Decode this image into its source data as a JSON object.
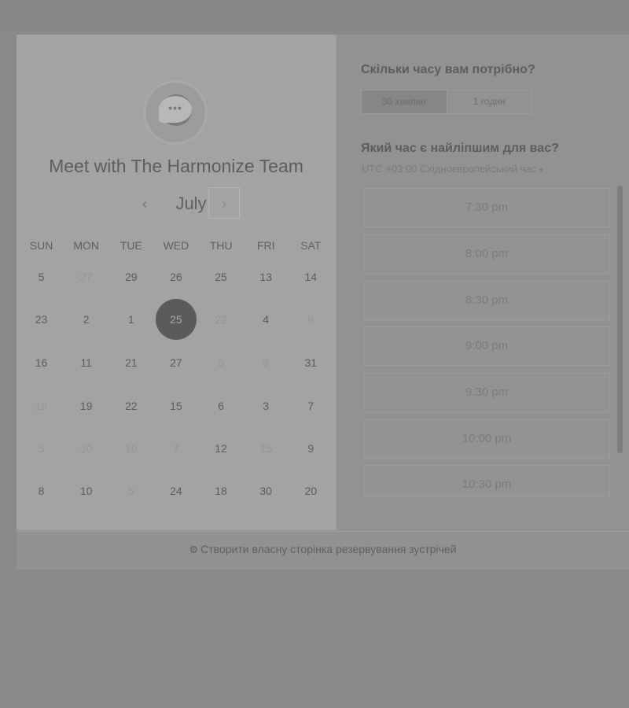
{
  "colors": {
    "selected_day": "#5b5b5b",
    "background": "#8a8a8a"
  },
  "left": {
    "title": "Meet with The Harmonize Team",
    "avatar_icon": "chat-bubble-icon",
    "avatar_text": "•••",
    "prev_icon": "‹",
    "month": "July",
    "next_icon": "›",
    "weekdays": [
      "SUN",
      "MON",
      "TUE",
      "WED",
      "THU",
      "FRI",
      "SAT"
    ],
    "weeks": [
      [
        "5",
        "27",
        "29",
        "26",
        "25",
        "13",
        "14"
      ],
      [
        "23",
        "2",
        "1",
        "25",
        "22",
        "4",
        "6"
      ],
      [
        "16",
        "11",
        "21",
        "27",
        "5",
        "8",
        "31"
      ],
      [
        "15",
        "19",
        "22",
        "15",
        "6",
        "3",
        "7"
      ],
      [
        "5",
        "30",
        "10",
        "7",
        "12",
        "15",
        "9"
      ],
      [
        "8",
        "10",
        "5",
        "24",
        "18",
        "30",
        "20"
      ]
    ],
    "selected": "25"
  },
  "right": {
    "duration_question": "Скільки часу вам потрібно?",
    "durations": [
      "30 хвилин",
      "1 годин"
    ],
    "time_question": "Який час є найліпшим для вас?",
    "timezone": "UTC +03:00 Східноєвропейський час",
    "timezone_caret": "▾",
    "slots": [
      "7:30 pm",
      "8:00 pm",
      "8:30 pm",
      "9:00 pm",
      "9:30 pm",
      "10:00 pm",
      "10:30 pm"
    ]
  },
  "footer": {
    "icon": "hubspot-sprocket-icon",
    "icon_glyph": "⚙",
    "link": "Створити власну сторінка резервування зустрічей"
  }
}
